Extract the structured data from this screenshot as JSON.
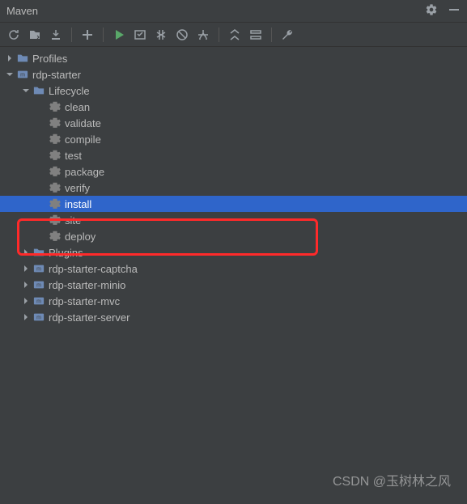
{
  "title": "Maven",
  "toolbar": {
    "reload": "Reload",
    "generate_sources": "Generate Sources",
    "download_sources": "Download Sources",
    "add": "Add Maven Project",
    "run": "Run",
    "execute": "Execute Goal",
    "toggle_offline": "Toggle Offline",
    "skip_tests": "Skip Tests",
    "show_deps": "Show Dependencies",
    "collapse": "Collapse All",
    "expand": "Expand All",
    "settings": "Settings"
  },
  "tree": {
    "profiles": "Profiles",
    "project": "rdp-starter",
    "lifecycle": {
      "label": "Lifecycle",
      "phases": [
        "clean",
        "validate",
        "compile",
        "test",
        "package",
        "verify",
        "install",
        "site",
        "deploy"
      ],
      "selected_index": 6
    },
    "plugins": "Plugins",
    "modules": [
      "rdp-starter-captcha",
      "rdp-starter-minio",
      "rdp-starter-mvc",
      "rdp-starter-server"
    ]
  },
  "watermark": "CSDN @玉树林之风",
  "colors": {
    "bg": "#3c3f41",
    "selection": "#2f65ca",
    "text": "#bbbbbb",
    "run_green": "#59a869",
    "highlight": "#ff2a2a"
  }
}
